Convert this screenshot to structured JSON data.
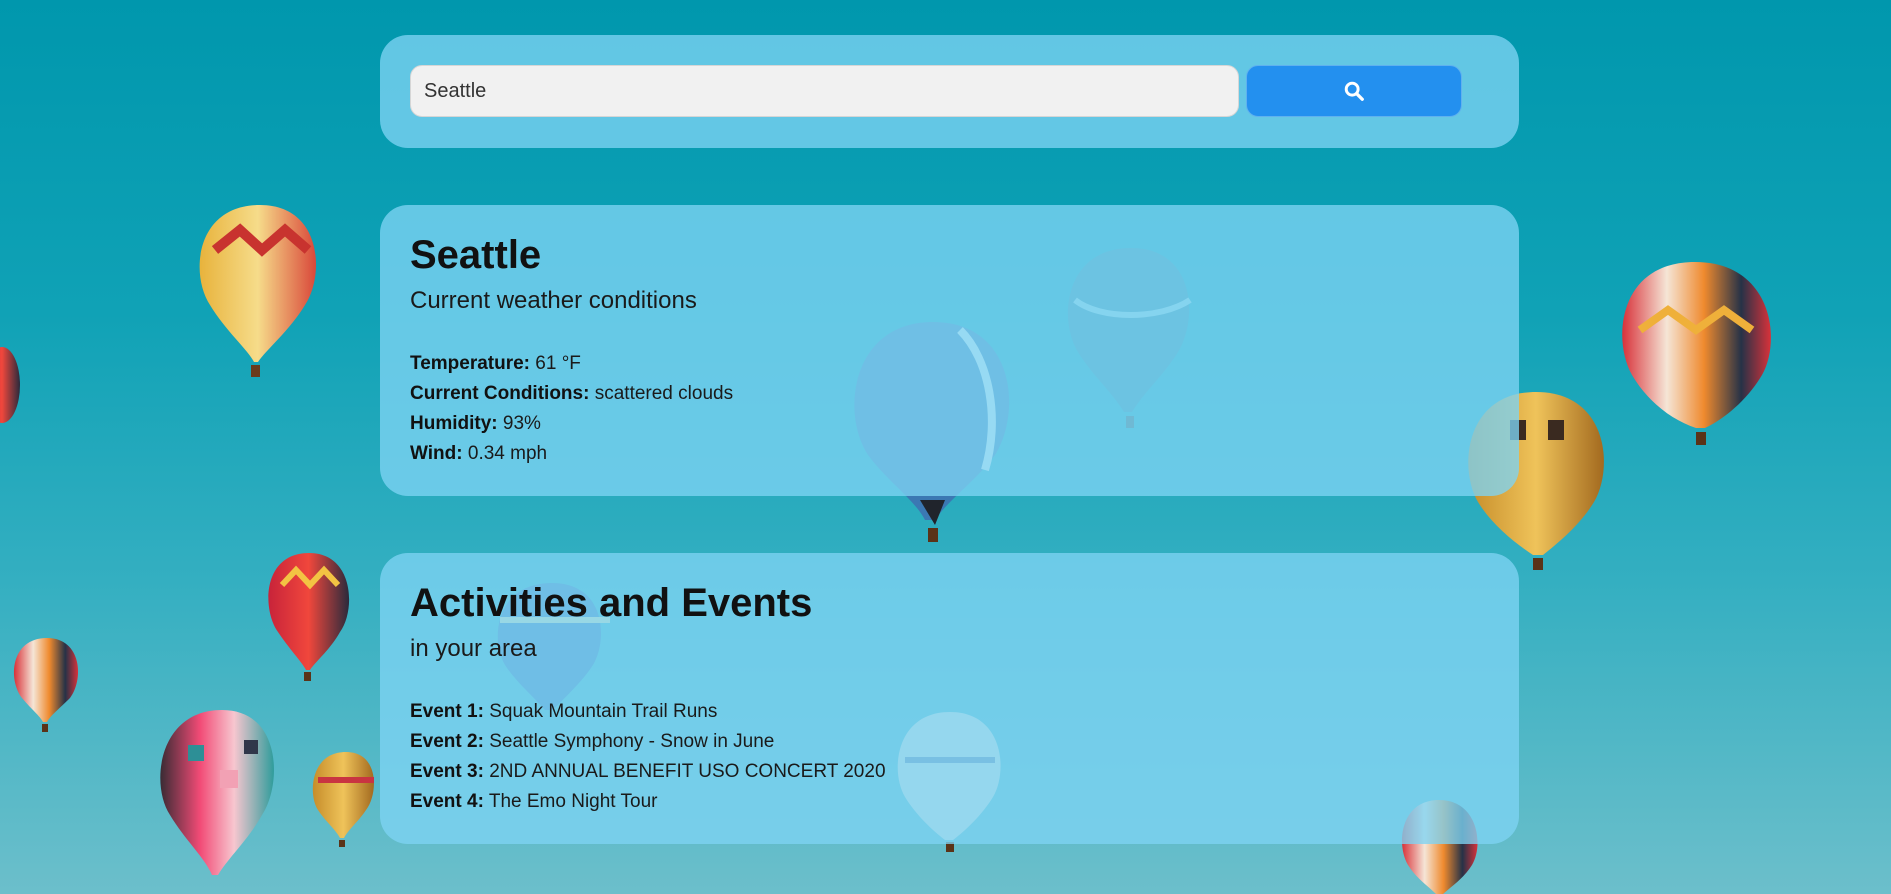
{
  "search": {
    "value": "Seattle",
    "button_icon": "search-icon"
  },
  "weather": {
    "city": "Seattle",
    "subtitle": "Current weather conditions",
    "rows": [
      {
        "label": "Temperature:",
        "value": "61 °F"
      },
      {
        "label": "Current Conditions:",
        "value": "scattered clouds"
      },
      {
        "label": "Humidity:",
        "value": "93%"
      },
      {
        "label": "Wind:",
        "value": "0.34 mph"
      }
    ]
  },
  "events": {
    "title": "Activities and Events",
    "subtitle": "in your area",
    "rows": [
      {
        "label": "Event 1:",
        "value": "Squak Mountain Trail Runs"
      },
      {
        "label": "Event 2:",
        "value": "Seattle Symphony - Snow in June"
      },
      {
        "label": "Event 3:",
        "value": "2ND ANNUAL BENEFIT USO CONCERT 2020"
      },
      {
        "label": "Event 4:",
        "value": "The Emo Night Tour"
      }
    ]
  },
  "colors": {
    "search_button": "#2390ef",
    "panel": "#7dd4f3",
    "sky_top": "#0097ad",
    "sky_bottom": "#6cbfcb"
  }
}
